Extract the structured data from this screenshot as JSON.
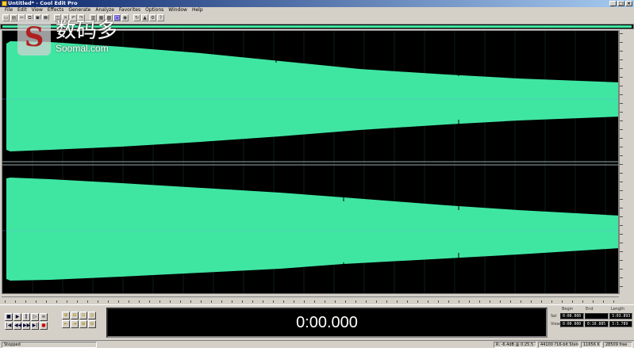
{
  "window": {
    "title": "Untitled* - Cool Edit Pro",
    "minimize": "_",
    "maximize": "□",
    "close": "×"
  },
  "menu": [
    "File",
    "Edit",
    "View",
    "Effects",
    "Generate",
    "Analyze",
    "Favorites",
    "Options",
    "Window",
    "Help"
  ],
  "toolbar": {
    "icons": [
      "open-icon",
      "save-icon",
      "cut-icon",
      "copy-icon",
      "paste-icon",
      "mix-paste-icon",
      "trim-icon",
      "delete-icon",
      "undo-icon",
      "redo-icon",
      "edit-view-icon",
      "multitrack-icon",
      "spectral-icon",
      "waveform-icon",
      "cd-icon",
      "loop-icon",
      "marker-icon",
      "settings-icon",
      "help-icon"
    ]
  },
  "watermark": {
    "cn": "数码多",
    "en": "Soomal.com",
    "logo_letter": "S"
  },
  "waveform": {
    "color": "#3fe6a2",
    "background": "#000000",
    "channels": 2
  },
  "time_display": {
    "value": "0:00.000"
  },
  "selection": {
    "headers": [
      "Begin",
      "End",
      "Length"
    ],
    "rows": [
      {
        "label": "Sel",
        "begin": "0:00.000",
        "end": "",
        "length": "3:03.893"
      },
      {
        "label": "View",
        "begin": "0:00.000",
        "end": "0:10.085",
        "length": "3:3.789"
      }
    ]
  },
  "status": {
    "state": "Stopped",
    "level": "R: -6.4dB @ 0:25.5 ?",
    "format": "44100 ?16-bit Stereo",
    "size": "11656 K",
    "free": "28509 free"
  }
}
